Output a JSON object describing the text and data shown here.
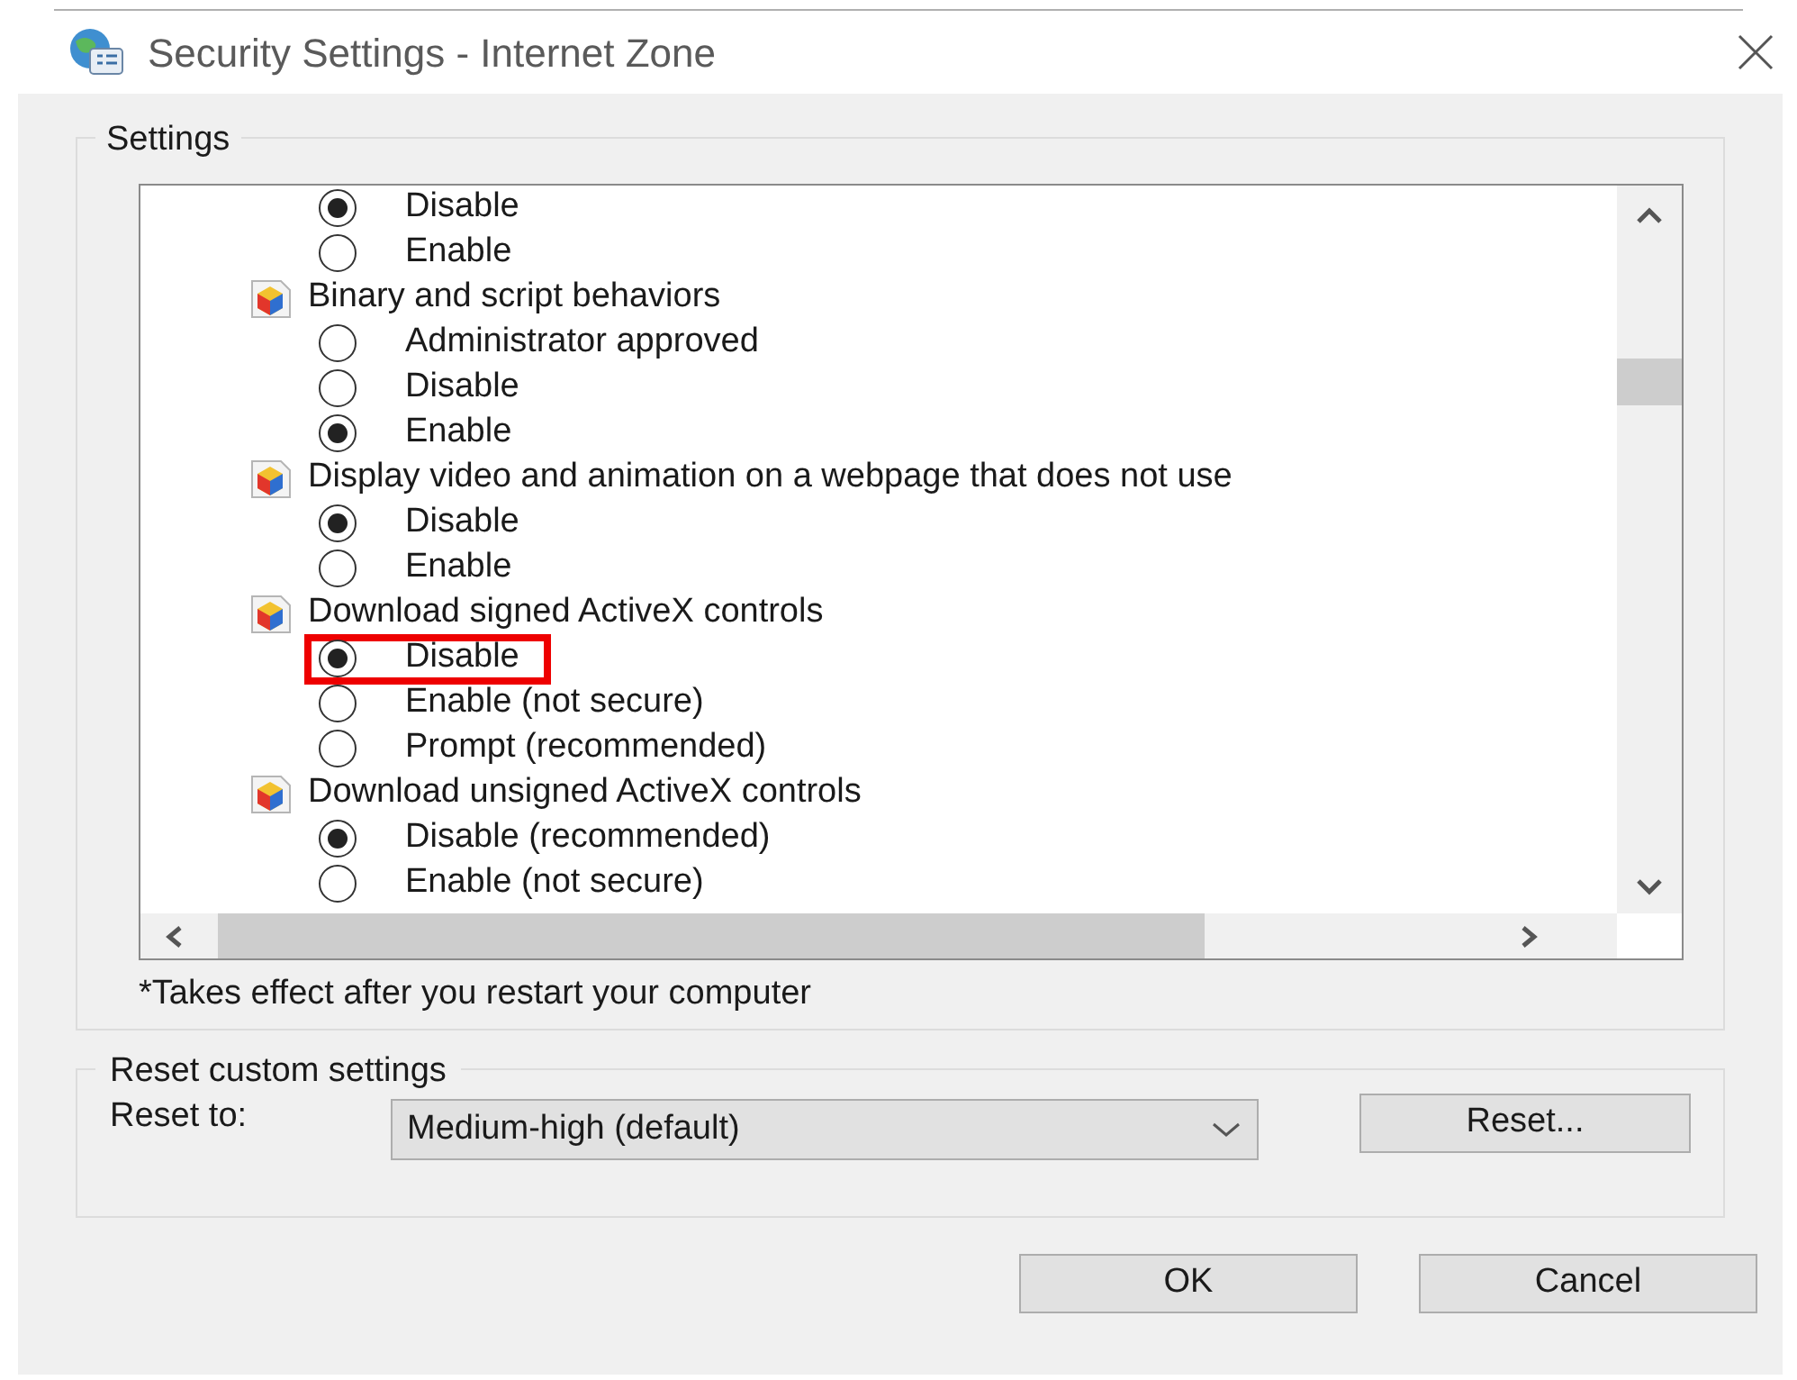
{
  "window": {
    "title": "Security Settings - Internet Zone"
  },
  "settings": {
    "title": "Settings",
    "rows": [
      {
        "kind": "option",
        "label": "Disable",
        "selected": true,
        "highlighted": false
      },
      {
        "kind": "option",
        "label": "Enable",
        "selected": false,
        "highlighted": false
      },
      {
        "kind": "setting",
        "label": "Binary and script behaviors"
      },
      {
        "kind": "option",
        "label": "Administrator approved",
        "selected": false,
        "highlighted": false
      },
      {
        "kind": "option",
        "label": "Disable",
        "selected": false,
        "highlighted": false
      },
      {
        "kind": "option",
        "label": "Enable",
        "selected": true,
        "highlighted": false
      },
      {
        "kind": "setting",
        "label": "Display video and animation on a webpage that does not use"
      },
      {
        "kind": "option",
        "label": "Disable",
        "selected": true,
        "highlighted": false
      },
      {
        "kind": "option",
        "label": "Enable",
        "selected": false,
        "highlighted": false
      },
      {
        "kind": "setting",
        "label": "Download signed ActiveX controls"
      },
      {
        "kind": "option",
        "label": "Disable",
        "selected": true,
        "highlighted": true
      },
      {
        "kind": "option",
        "label": "Enable (not secure)",
        "selected": false,
        "highlighted": false
      },
      {
        "kind": "option",
        "label": "Prompt (recommended)",
        "selected": false,
        "highlighted": false
      },
      {
        "kind": "setting",
        "label": "Download unsigned ActiveX controls"
      },
      {
        "kind": "option",
        "label": "Disable (recommended)",
        "selected": true,
        "highlighted": false
      },
      {
        "kind": "option",
        "label": "Enable (not secure)",
        "selected": false,
        "highlighted": false
      }
    ],
    "note": "*Takes effect after you restart your computer"
  },
  "reset": {
    "title": "Reset custom settings",
    "label": "Reset to:",
    "value": "Medium-high (default)",
    "button": "Reset..."
  },
  "buttons": [
    "OK",
    "Cancel"
  ]
}
